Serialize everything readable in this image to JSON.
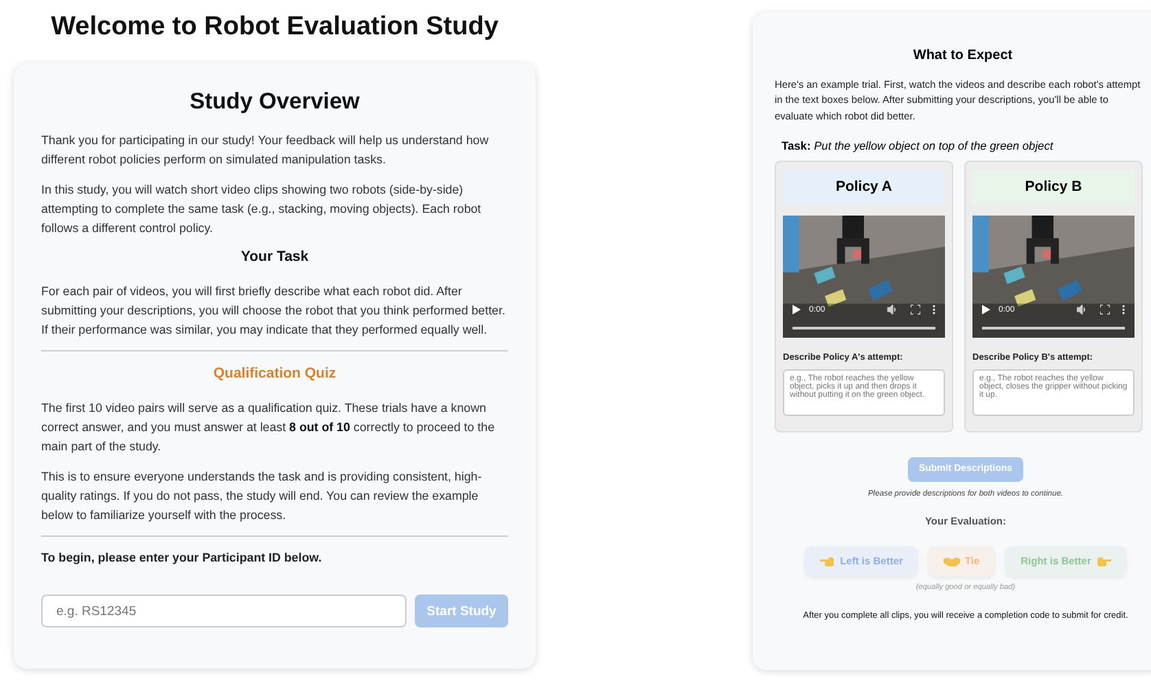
{
  "page_title": "Welcome to Robot Evaluation Study",
  "overview": {
    "title": "Study Overview",
    "intro": [
      "Thank you for participating in our study! Your feedback will help us understand how different robot policies perform on simulated manipulation tasks.",
      "In this study, you will watch short video clips showing two robots (side-by-side) attempting to complete the same task (e.g., stacking, moving objects). Each robot follows a different control policy."
    ],
    "task_heading": "Your Task",
    "task_text": "For each pair of videos, you will first briefly describe what each robot did. After submitting your descriptions, you will choose the robot that you think performed better. If their performance was similar, you may indicate that they performed equally well.",
    "quiz_heading": "Qualification Quiz",
    "quiz_text": [
      "The first 10 video pairs will serve as a qualification quiz. These trials have a known correct answer, and you must answer at least **8 out of 10** correctly to proceed to the main part of the study.",
      "This is to ensure everyone understands the task and is providing consistent, high-quality ratings. If you do not pass, the study will end. You can review the example below to familiarize yourself with the process."
    ],
    "begin_text": "To begin, please enter your Participant ID below.",
    "id_field": {
      "placeholder": "e.g. RS12345"
    },
    "start_button": {
      "label": "Start Study",
      "disabled": true
    }
  },
  "example": {
    "title": "What to Expect",
    "intro": "Here's an example trial. First, watch the videos and describe each robot's attempt in the text boxes below. After submitting your descriptions, you'll be able to evaluate which robot did better.",
    "task_label": "Task:",
    "task_text": "Put the yellow object on top of the green object",
    "policies": [
      {
        "name": "Policy A",
        "color": "#e6f0fa",
        "time": "0:00",
        "level": 0,
        "prompt": "Describe Policy A's attempt:",
        "placeholder": "e.g., The robot reaches the yellow object, picks it up and then drops it without putting it on the green object."
      },
      {
        "name": "Policy B",
        "color": "#e8f5e9",
        "time": "0:00",
        "level": 0,
        "prompt": "Describe Policy B's attempt:",
        "placeholder": "e.g., The robot reaches the yellow object, closes the gripper without picking it up."
      }
    ],
    "submit_button": {
      "label": "Submit Descriptions",
      "disabled": true
    },
    "submit_hint": "Please provide descriptions for both videos to continue.",
    "evaluation_heading": "Your Evaluation:",
    "choices": [
      {
        "label": "Left is Better",
        "kind": "left",
        "color": "#8fb0e6",
        "disabled": true
      },
      {
        "label": "Tie",
        "kind": "tie",
        "color": "#f0b77a",
        "disabled": true
      },
      {
        "label": "Right is Better",
        "kind": "right",
        "color": "#92c49a",
        "disabled": true
      }
    ],
    "tie_note": "(equally good or equally bad)",
    "footer": "After you complete all clips, you will receive a completion code to submit for credit."
  }
}
